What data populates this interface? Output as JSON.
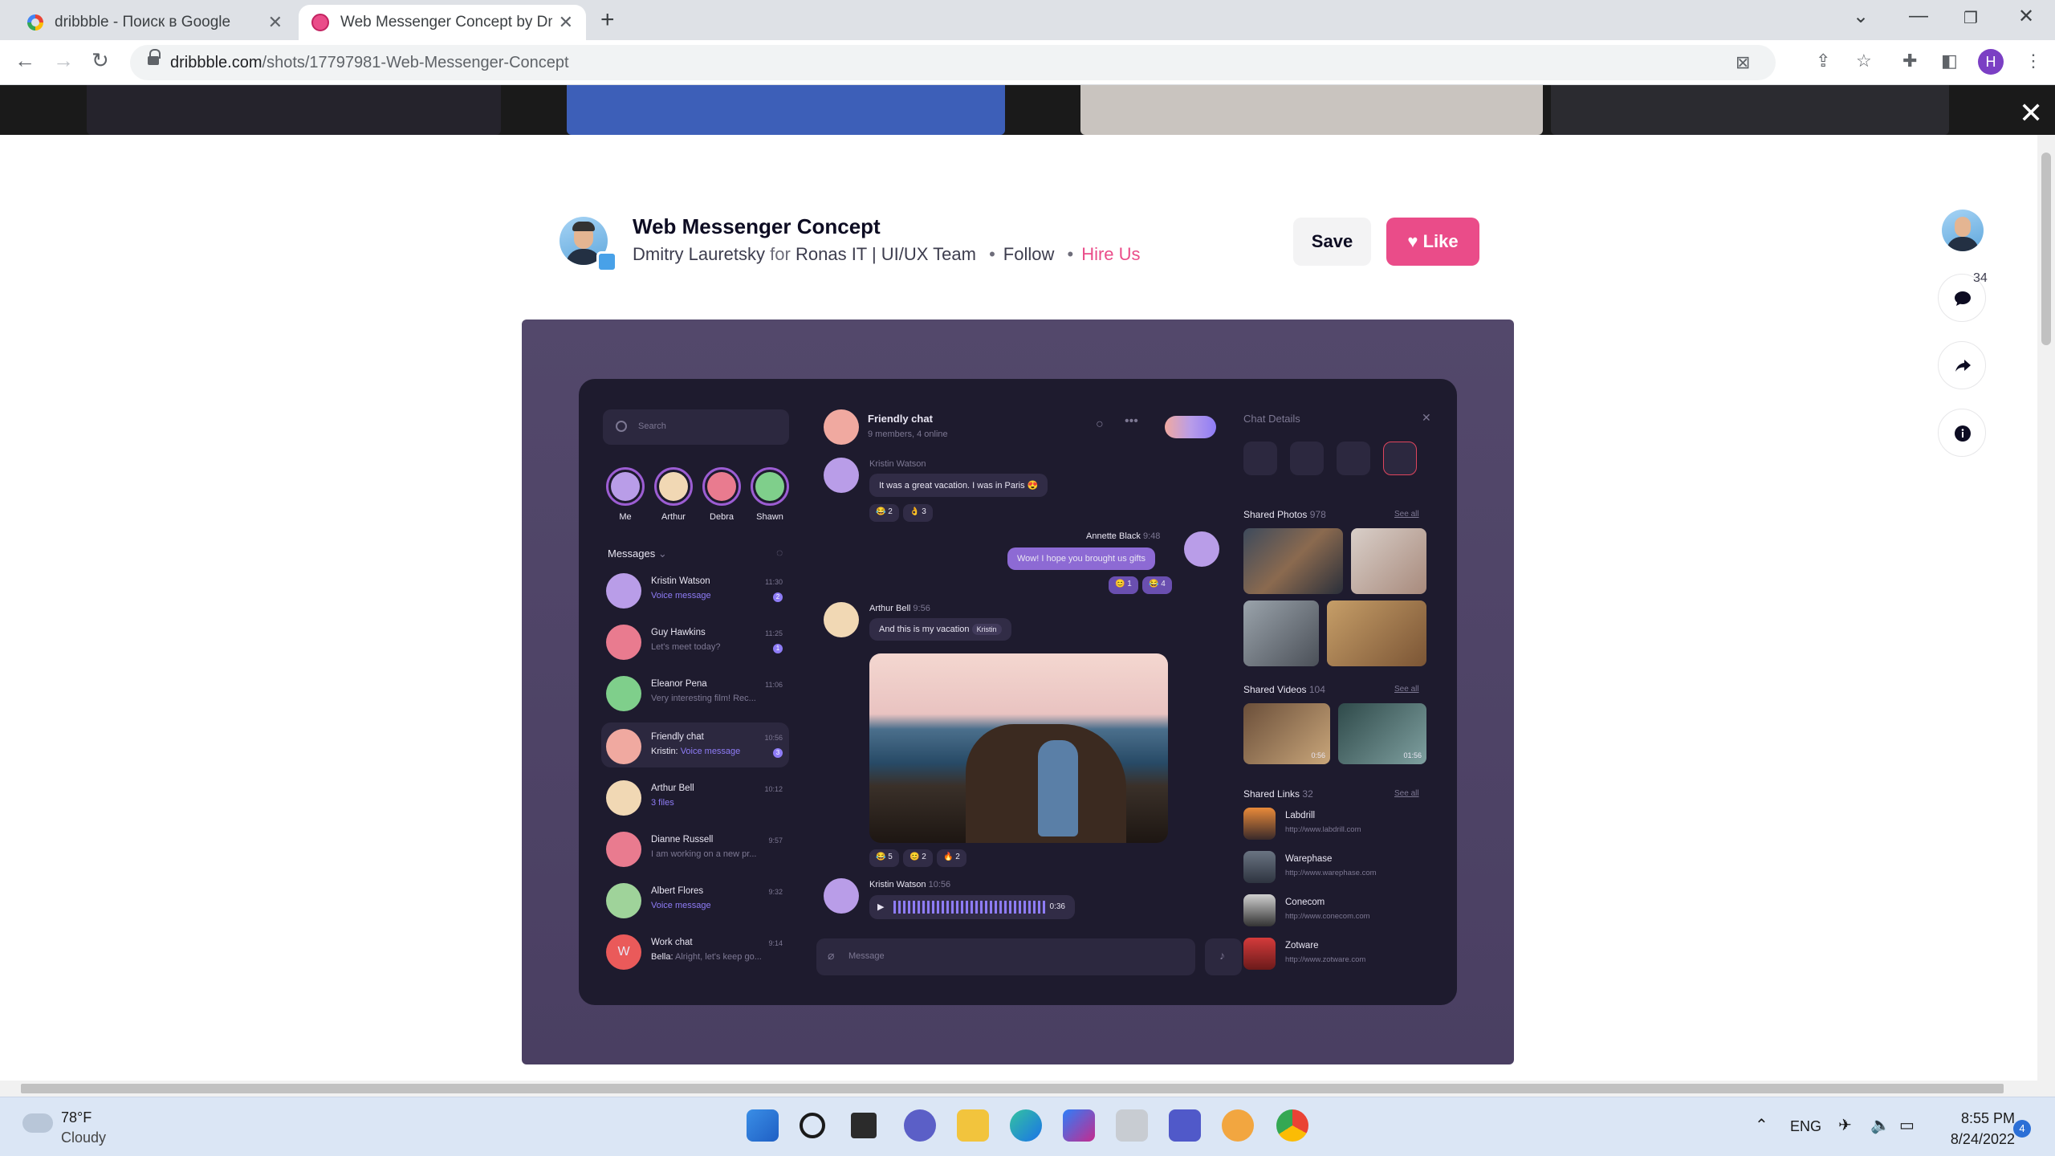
{
  "browser": {
    "tabs": [
      {
        "title": "dribbble - Поиск в Google",
        "active": false
      },
      {
        "title": "Web Messenger Concept by Dmi",
        "active": true
      }
    ],
    "new_tab": "+",
    "url_host": "dribbble.com",
    "url_path": "/shots/17797981-Web-Messenger-Concept",
    "profile_initial": "H"
  },
  "shot": {
    "title": "Web Messenger Concept",
    "author": "Dmitry Lauretsky",
    "for_word": "for",
    "team": "Ronas IT | UI/UX Team",
    "follow": "Follow",
    "hire": "Hire Us",
    "save_label": "Save",
    "like_label": "Like",
    "comment_count": "34"
  },
  "messenger": {
    "search_placeholder": "Search",
    "stories": [
      "Me",
      "Arthur",
      "Debra",
      "Shawn"
    ],
    "messages_header": "Messages",
    "chats": [
      {
        "name": "Kristin Watson",
        "preview": "Voice message",
        "time": "11:30",
        "badge": "2",
        "accent": true
      },
      {
        "name": "Guy Hawkins",
        "preview": "Let's meet today?",
        "time": "11:25",
        "badge": "1",
        "accent": false
      },
      {
        "name": "Eleanor Pena",
        "preview": "Very interesting film! Rec...",
        "time": "11:06",
        "badge": "",
        "accent": false
      },
      {
        "name": "Friendly chat",
        "preview_prefix": "Kristin:",
        "preview": "Voice message",
        "time": "10:56",
        "badge": "3",
        "accent": true
      },
      {
        "name": "Arthur Bell",
        "preview": "3 files",
        "time": "10:12",
        "badge": "",
        "accent": true
      },
      {
        "name": "Dianne Russell",
        "preview": "I am working on a new pr...",
        "time": "9:57",
        "badge": "",
        "accent": false
      },
      {
        "name": "Albert Flores",
        "preview": "Voice message",
        "time": "9:32",
        "badge": "",
        "accent": true
      },
      {
        "name": "Work chat",
        "preview_prefix": "Bella:",
        "preview": "Alright, let's keep go...",
        "time": "9:14",
        "badge": "",
        "accent": false,
        "initial": "W"
      }
    ],
    "conversation": {
      "title": "Friendly chat",
      "subtitle": "9 members, 4 online",
      "msg1_author": "Kristin Watson",
      "msg1_text": "It was a great vacation. I was in Paris 😍",
      "msg1_reacts": [
        "😂 2",
        "👌 3"
      ],
      "msg2_author": "Annette Black",
      "msg2_time": "9:48",
      "msg2_text": "Wow! I hope you brought us gifts",
      "msg2_reacts": [
        "😊 1",
        "😂 4"
      ],
      "msg3_author": "Arthur Bell",
      "msg3_time": "9:56",
      "msg3_text": "And this is my vacation",
      "msg3_mention": "Kristin",
      "photo_reacts": [
        "😂 5",
        "😊 2",
        "🔥 2"
      ],
      "msg4_author": "Kristin Watson",
      "msg4_time": "10:56",
      "voice_duration": "0:36",
      "input_placeholder": "Message"
    },
    "details": {
      "title": "Chat Details",
      "photos_label": "Shared Photos",
      "photos_count": "978",
      "videos_label": "Shared Videos",
      "videos_count": "104",
      "video_durations": [
        "0:56",
        "01:56"
      ],
      "links_label": "Shared Links",
      "links_count": "32",
      "see_all": "See all",
      "links": [
        {
          "name": "Labdrill",
          "url": "http://www.labdrill.com"
        },
        {
          "name": "Warephase",
          "url": "http://www.warephase.com"
        },
        {
          "name": "Conecom",
          "url": "http://www.conecom.com"
        },
        {
          "name": "Zotware",
          "url": "http://www.zotware.com"
        }
      ]
    }
  },
  "taskbar": {
    "temp": "78°F",
    "weather": "Cloudy",
    "lang": "ENG",
    "time": "8:55 PM",
    "date": "8/24/2022",
    "notifications": "4"
  }
}
